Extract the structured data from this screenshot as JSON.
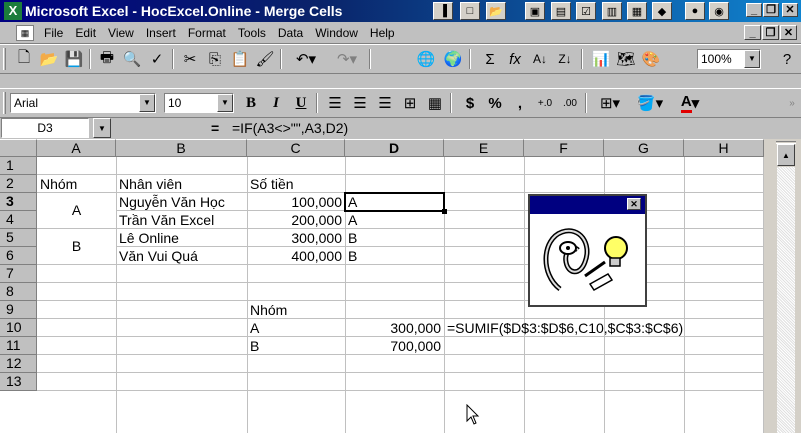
{
  "window": {
    "title": "Microsoft Excel - HocExcel.Online - Merge Cells",
    "app_icon": "excel-icon"
  },
  "menu": [
    "File",
    "Edit",
    "View",
    "Insert",
    "Format",
    "Tools",
    "Data",
    "Window",
    "Help"
  ],
  "format_toolbar": {
    "font": "Arial",
    "size": "10",
    "zoom": "100%"
  },
  "formula_bar": {
    "cell_ref": "D3",
    "equals": "=",
    "formula": "=IF(A3<>\"\",A3,D2)"
  },
  "columns": [
    "A",
    "B",
    "C",
    "D",
    "E",
    "F",
    "G",
    "H"
  ],
  "rows": [
    "1",
    "2",
    "3",
    "4",
    "5",
    "6",
    "7",
    "8",
    "9",
    "10",
    "11",
    "12",
    "13"
  ],
  "sheet": {
    "r2": {
      "a": "Nhóm",
      "b": "Nhân viên",
      "c": "Số tiền"
    },
    "group_a": "A",
    "group_b": "B",
    "r3": {
      "b": "Nguyễn Văn Học",
      "c": "100,000",
      "d": "A"
    },
    "r4": {
      "b": "Trần Văn Excel",
      "c": "200,000",
      "d": "A"
    },
    "r5": {
      "b": "Lê Online",
      "c": "300,000",
      "d": "B"
    },
    "r6": {
      "b": "Văn Vui Quá",
      "c": "400,000",
      "d": "B"
    },
    "r9": {
      "c": "Nhóm"
    },
    "r10": {
      "c": "A",
      "d": "300,000",
      "e": "=SUMIF($D$3:$D$6,C10,$C$3:$C$6)"
    },
    "r11": {
      "c": "B",
      "d": "700,000"
    }
  }
}
